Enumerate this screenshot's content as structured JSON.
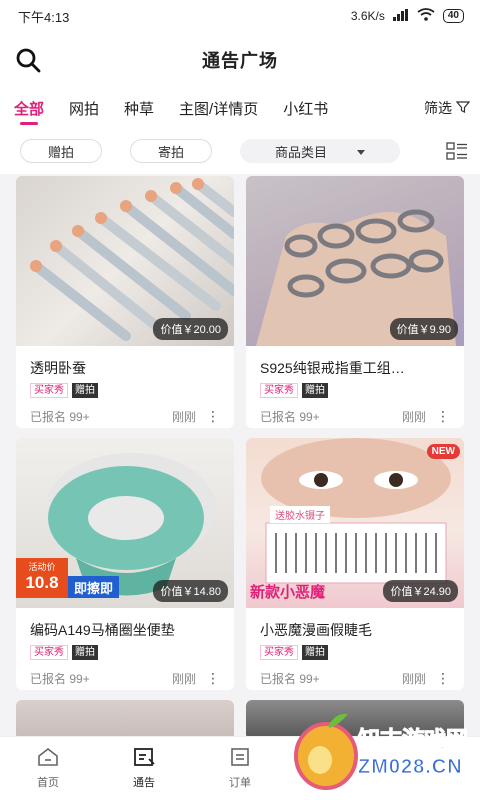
{
  "status_bar": {
    "time": "下午4:13",
    "net": "3.6K/s",
    "battery": "40"
  },
  "header": {
    "title": "通告广场"
  },
  "tabs": [
    {
      "label": "全部",
      "active": true
    },
    {
      "label": "网拍"
    },
    {
      "label": "种草"
    },
    {
      "label": "主图/详情页"
    },
    {
      "label": "小红书"
    }
  ],
  "filter": {
    "label": "筛选"
  },
  "chips": {
    "gift": "赠拍",
    "send": "寄拍",
    "category": "商品类目"
  },
  "cards": [
    {
      "name": "透明卧蚕",
      "price": "价值￥20.00",
      "tag1": "买家秀",
      "tag2": "赠拍",
      "signups": "已报名 99+",
      "time": "刚刚"
    },
    {
      "name": "S925纯银戒指重工组…",
      "price": "价值￥9.90",
      "tag1": "买家秀",
      "tag2": "赠拍",
      "signups": "已报名 99+",
      "time": "刚刚"
    },
    {
      "name": "编码A149马桶圈坐便垫",
      "price": "价值￥14.80",
      "tag1": "买家秀",
      "tag2": "赠拍",
      "signups": "已报名 99+",
      "time": "刚刚",
      "img_text1": "活动价",
      "img_text2": "10.8",
      "img_text3": "即擦即"
    },
    {
      "name": "小恶魔漫画假睫毛",
      "price": "价值￥24.90",
      "tag1": "买家秀",
      "tag2": "赠拍",
      "signups": "已报名 99+",
      "time": "刚刚",
      "img_text1": "NEW",
      "img_text2": "新款小恶魔",
      "img_text3": "送胶水镊子"
    }
  ],
  "bottom_nav": [
    {
      "label": "首页"
    },
    {
      "label": "通告",
      "active": true
    },
    {
      "label": "订单"
    }
  ],
  "watermark": {
    "text": "知末游戏网",
    "url": "ZM028.CN"
  }
}
